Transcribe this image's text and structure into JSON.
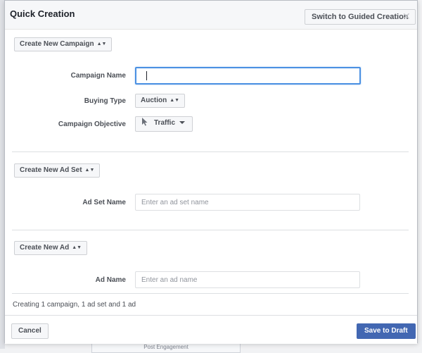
{
  "dialog": {
    "title": "Quick Creation",
    "guided_button": "Switch to Guided Creation",
    "close_icon": "close-icon"
  },
  "campaign": {
    "create_label": "Create New Campaign",
    "name_label": "Campaign Name",
    "name_value": "",
    "buying_type_label": "Buying Type",
    "buying_type_value": "Auction",
    "objective_label": "Campaign Objective",
    "objective_value": "Traffic",
    "objective_icon": "cursor-pointer-icon"
  },
  "ad_set": {
    "create_label": "Create New Ad Set",
    "name_label": "Ad Set Name",
    "name_placeholder": "Enter an ad set name"
  },
  "ad": {
    "create_label": "Create New Ad",
    "name_label": "Ad Name",
    "name_placeholder": "Enter an ad name"
  },
  "footer": {
    "summary": "Creating 1 campaign, 1 ad set and 1 ad",
    "cancel_label": "Cancel",
    "save_label": "Save to Draft"
  },
  "background": {
    "tab_label": "Post Engagement"
  },
  "colors": {
    "primary": "#4267b2",
    "focus": "#4a90e2"
  }
}
